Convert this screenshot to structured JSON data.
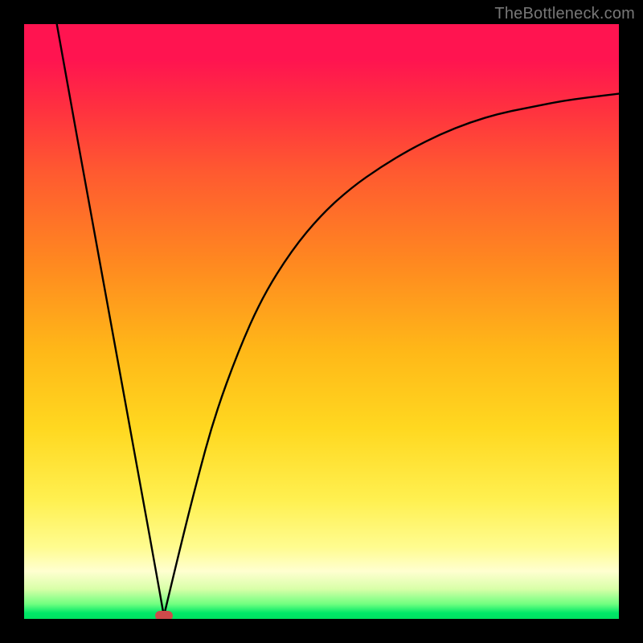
{
  "watermark": "TheBottleneck.com",
  "chart_data": {
    "type": "line",
    "title": "",
    "xlabel": "",
    "ylabel": "",
    "xlim": [
      0,
      1
    ],
    "ylim": [
      0,
      1
    ],
    "dot": {
      "x": 0.235,
      "y": 0.005
    },
    "series": [
      {
        "name": "left-branch",
        "x": [
          0.055,
          0.08,
          0.1,
          0.12,
          0.14,
          0.16,
          0.18,
          0.2,
          0.22,
          0.235
        ],
        "values": [
          1.0,
          0.86,
          0.75,
          0.64,
          0.53,
          0.42,
          0.31,
          0.2,
          0.09,
          0.005
        ]
      },
      {
        "name": "right-branch",
        "x": [
          0.235,
          0.26,
          0.29,
          0.32,
          0.36,
          0.4,
          0.45,
          0.5,
          0.55,
          0.6,
          0.65,
          0.7,
          0.75,
          0.8,
          0.85,
          0.9,
          0.95,
          1.0
        ],
        "values": [
          0.005,
          0.11,
          0.23,
          0.34,
          0.45,
          0.54,
          0.62,
          0.68,
          0.725,
          0.76,
          0.79,
          0.815,
          0.835,
          0.85,
          0.86,
          0.87,
          0.877,
          0.883
        ]
      }
    ],
    "colors": {
      "curve": "#000000",
      "dot": "#cf4a4a",
      "gradient_top": "#ff1450",
      "gradient_bottom": "#00e060"
    }
  }
}
